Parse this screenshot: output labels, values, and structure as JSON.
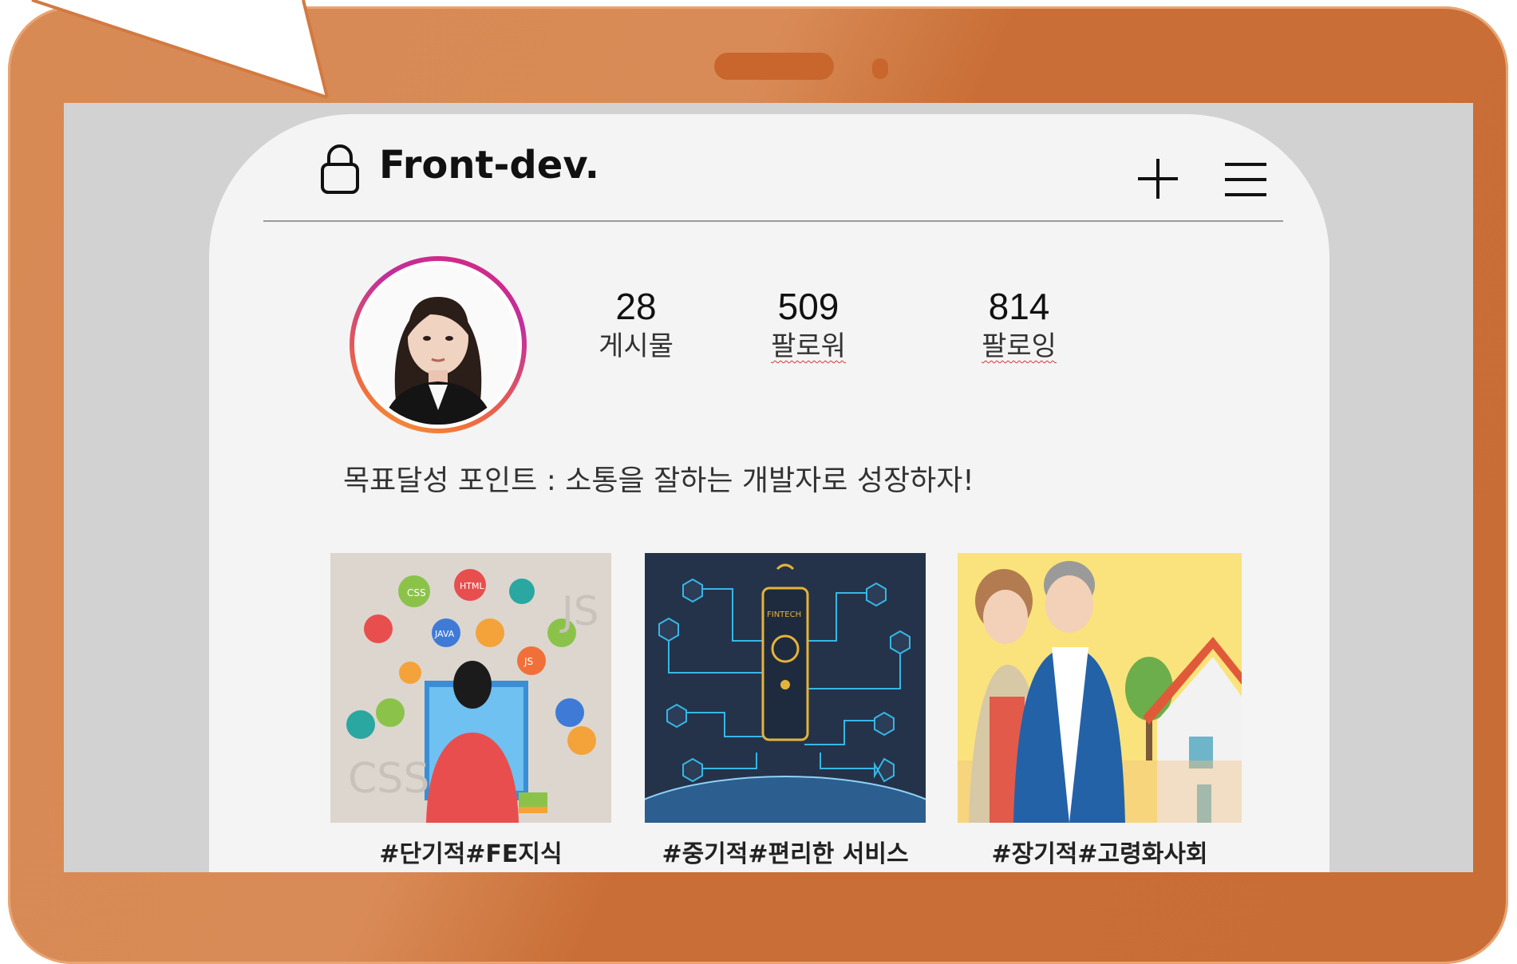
{
  "app": {
    "title": "Front-dev."
  },
  "header_icons": [
    "lock-icon",
    "plus-icon",
    "hamburger-menu-icon"
  ],
  "profile": {
    "stats": [
      {
        "value": "28",
        "label": "게시물"
      },
      {
        "value": "509",
        "label": "팔로워"
      },
      {
        "value": "814",
        "label": "팔로잉"
      }
    ],
    "bio": "목표달성 포인트 : 소통을 잘하는 개발자로 성장하자!"
  },
  "posts": [
    {
      "caption": "#단기적#FE지식",
      "image": "frontend-developer-illustration",
      "tags": [
        "CSS",
        "HTML",
        "JAVA",
        "JS",
        "CSS",
        "JS"
      ]
    },
    {
      "caption": "#중기적#편리한 서비스",
      "image": "fintech-network-illustration",
      "tags": [
        "FINTECH"
      ]
    },
    {
      "caption": "#장기적#고령화사회",
      "image": "elderly-couple-illustration",
      "tags": []
    }
  ],
  "colors": {
    "tablet_frame": "#d27a42",
    "screen_bg": "#d2d2d2",
    "phone_bg": "#f4f4f4",
    "avatar_ring_start": "#d6287f",
    "avatar_ring_end": "#f4a23a"
  }
}
